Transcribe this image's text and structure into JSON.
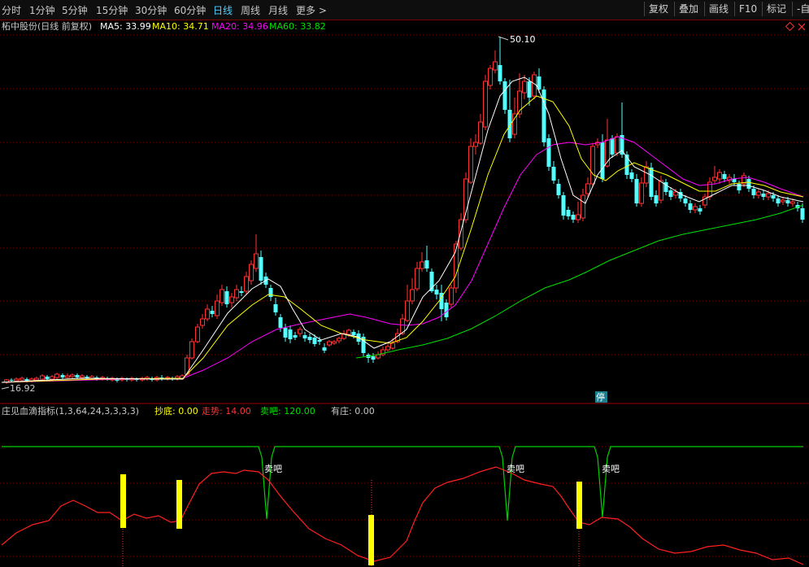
{
  "toolbar": {
    "timeframes": [
      "分时",
      "1分钟",
      "5分钟",
      "15分钟",
      "30分钟",
      "60分钟",
      "日线",
      "周线",
      "月线",
      "更多"
    ],
    "active_timeframe": "日线",
    "more_arrow": ">",
    "right_buttons": [
      "复权",
      "叠加",
      "画线",
      "F10",
      "标记",
      "-自选"
    ]
  },
  "main_chart": {
    "title": "柘中股份(日线 前复权)",
    "ma": [
      {
        "label": "MA5: 33.99",
        "color": "#ffffff"
      },
      {
        "label": "MA10: 34.71",
        "color": "#ffff00"
      },
      {
        "label": "MA20: 34.96",
        "color": "#ff00ff"
      },
      {
        "label": "MA60: 33.82",
        "color": "#00e000"
      }
    ],
    "high_label": "50.10",
    "low_label": "16.92",
    "halt_badge": "停",
    "colors": {
      "up": "#ff3232",
      "down": "#54ffff",
      "grid": "#7a0000"
    }
  },
  "indicator": {
    "title": "庄见血滴指标(1,3,64,24,3,3,3,3)",
    "values": [
      {
        "label": "抄底: 0.00",
        "color": "#ffff00"
      },
      {
        "label": "走势: 14.00",
        "color": "#ff3232"
      },
      {
        "label": "卖吧: 120.00",
        "color": "#00e000"
      },
      {
        "label": "有庄: 0.00",
        "color": "#c8c8c8"
      }
    ],
    "sell_label": "卖吧",
    "colors": {
      "trend": "#ff2020",
      "sell": "#00d000",
      "bottom": "#ffff00"
    }
  }
}
